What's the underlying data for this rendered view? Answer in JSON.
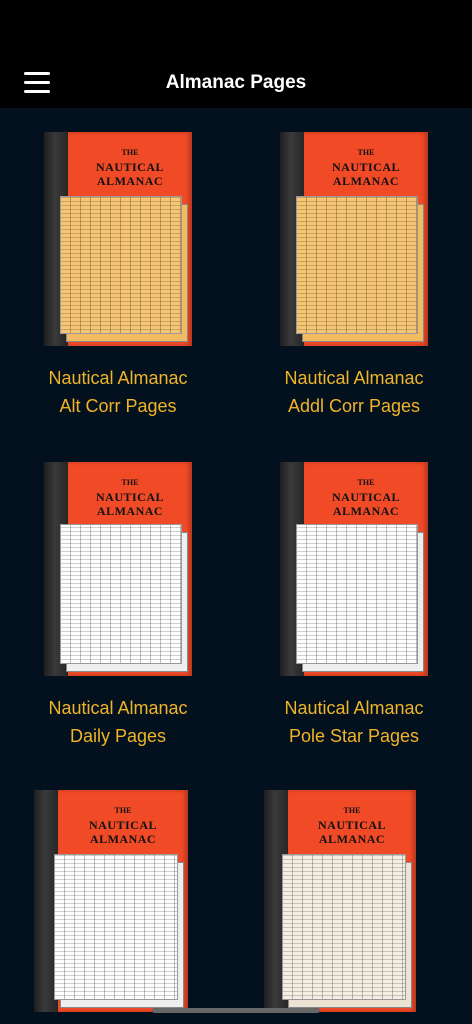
{
  "header": {
    "title": "Almanac Pages"
  },
  "cover": {
    "the": "THE",
    "line1": "NAUTICAL",
    "line2": "ALMANAC"
  },
  "items": [
    {
      "line1": "Nautical Almanac",
      "line2": "Alt Corr Pages",
      "page_style": "tan"
    },
    {
      "line1": "Nautical Almanac",
      "line2": "Addl Corr Pages",
      "page_style": "tan"
    },
    {
      "line1": "Nautical Almanac",
      "line2": "Daily Pages",
      "page_style": "white"
    },
    {
      "line1": "Nautical Almanac",
      "line2": "Pole Star Pages",
      "page_style": "white"
    },
    {
      "line1": "",
      "line2": "",
      "page_style": "white"
    },
    {
      "line1": "",
      "line2": "",
      "page_style": "cream"
    }
  ]
}
